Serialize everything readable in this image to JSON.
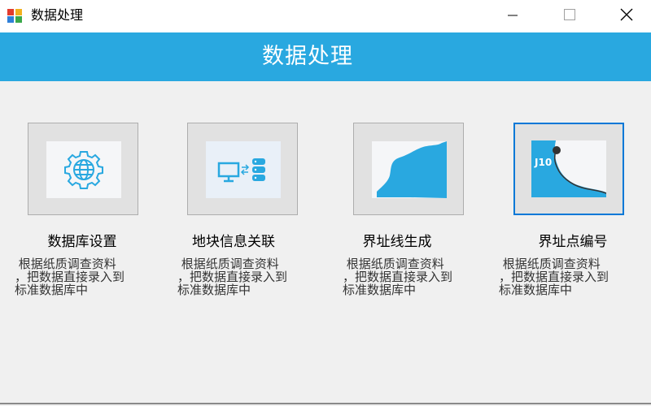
{
  "window": {
    "title": "数据处理",
    "icon": "app-window-icon",
    "controls": {
      "minimize": "minimize-icon",
      "maximize": "maximize-icon",
      "close": "close-icon"
    }
  },
  "header": {
    "title": "数据处理",
    "background": "#29a8e0"
  },
  "tiles": [
    {
      "label": "数据库设置",
      "icon": "globe-gear-icon",
      "description": " 根据纸质调查资料\n，把数据直接录入到\n标准数据库中"
    },
    {
      "label": "地块信息关联",
      "icon": "computer-database-icon",
      "description": " 根据纸质调查资料\n，把数据直接录入到\n标准数据库中"
    },
    {
      "label": "界址线生成",
      "icon": "boundary-line-icon",
      "description": " 根据纸质调查资料\n，把数据直接录入到\n标准数据库中"
    },
    {
      "label": "界址点编号",
      "icon": "boundary-point-icon",
      "point_label": "J10",
      "description": " 根据纸质调查资料\n，把数据直接录入到\n标准数据库中"
    }
  ],
  "colors": {
    "accent": "#29a8e0",
    "selection": "#0078d7"
  }
}
